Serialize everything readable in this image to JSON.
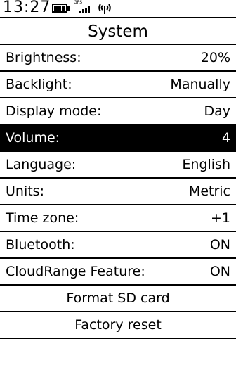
{
  "status": {
    "time": "13:27",
    "gps_label": "GPS",
    "battery_icon": "battery-icon",
    "signal_icon": "gps-signal-icon",
    "antenna_icon": "antenna-icon"
  },
  "screen": {
    "title": "System"
  },
  "settings": [
    {
      "label": "Brightness:",
      "value": "20%"
    },
    {
      "label": "Backlight:",
      "value": "Manually"
    },
    {
      "label": "Display mode:",
      "value": "Day"
    },
    {
      "label": "Volume:",
      "value": "4"
    },
    {
      "label": "Language:",
      "value": "English"
    },
    {
      "label": "Units:",
      "value": "Metric"
    },
    {
      "label": "Time zone:",
      "value": "+1"
    },
    {
      "label": "Bluetooth:",
      "value": "ON"
    },
    {
      "label": "CloudRange Feature:",
      "value": "ON"
    }
  ],
  "actions": {
    "format_sd": "Format SD card",
    "factory_reset": "Factory reset"
  },
  "colors": {
    "selected_bg": "#000000",
    "selected_fg": "#ffffff"
  }
}
